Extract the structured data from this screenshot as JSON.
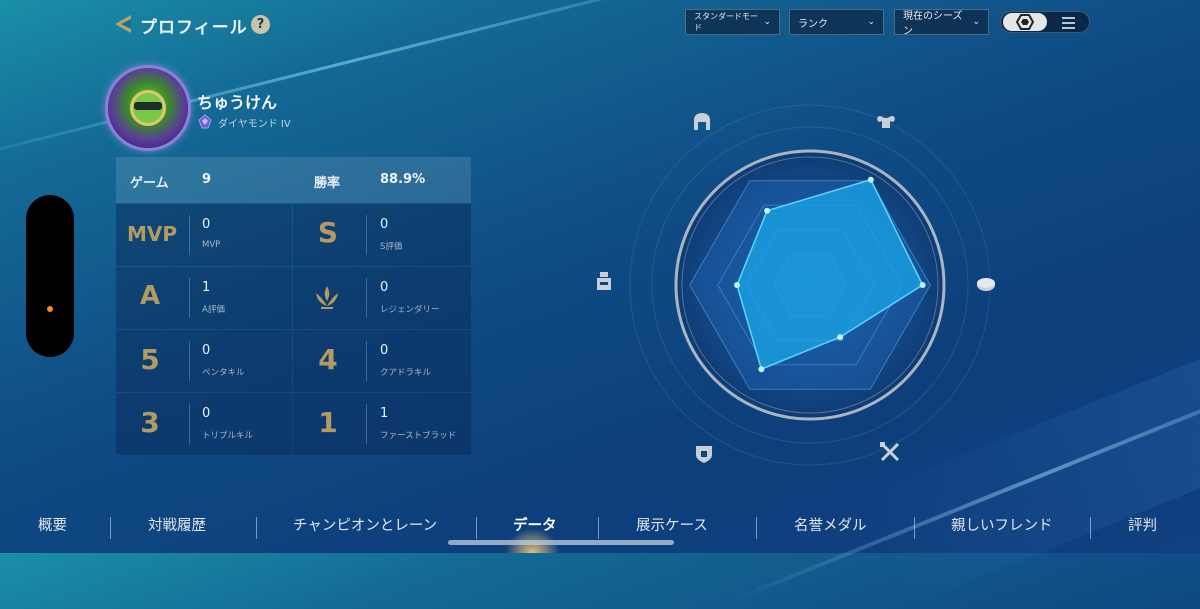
{
  "header": {
    "title": "プロフィール",
    "help": "?"
  },
  "filters": {
    "mode": "スタンダードモード",
    "queue": "ランク",
    "season": "現在のシーズン"
  },
  "player": {
    "name": "ちゅうけん",
    "rank": "ダイヤモンド IV"
  },
  "stats": {
    "games_label": "ゲーム",
    "games_value": "9",
    "winrate_label": "勝率",
    "winrate_value": "88.9%",
    "items": [
      {
        "glyph": "MVP",
        "value": "0",
        "label": "MVP"
      },
      {
        "glyph": "S",
        "value": "0",
        "label": "S評価"
      },
      {
        "glyph": "A",
        "value": "1",
        "label": "A評価"
      },
      {
        "glyph": "",
        "value": "0",
        "label": "レジェンダリー"
      },
      {
        "glyph": "5",
        "value": "0",
        "label": "ペンタキル"
      },
      {
        "glyph": "4",
        "value": "0",
        "label": "クアドラキル"
      },
      {
        "glyph": "3",
        "value": "0",
        "label": "トリプルキル"
      },
      {
        "glyph": "1",
        "value": "1",
        "label": "ファーストブラッド"
      }
    ]
  },
  "radar": {
    "axes": [
      "top-left",
      "top-right",
      "right",
      "bottom-right",
      "bottom-left",
      "left"
    ],
    "values": [
      0.67,
      0.95,
      0.88,
      0.47,
      0.76,
      0.57
    ],
    "colors": {
      "fill": "#1aa6e8",
      "stroke": "#59d8ff",
      "ring": "#a9b6c2"
    }
  },
  "nav": {
    "tabs": [
      "概要",
      "対戦履歴",
      "チャンピオンとレーン",
      "データ",
      "展示ケース",
      "名誉メダル",
      "親しいフレンド",
      "評判"
    ],
    "active": "データ"
  },
  "colors": {
    "accent_gold": "#b29a62",
    "active_dot": "#ff8a1a"
  }
}
